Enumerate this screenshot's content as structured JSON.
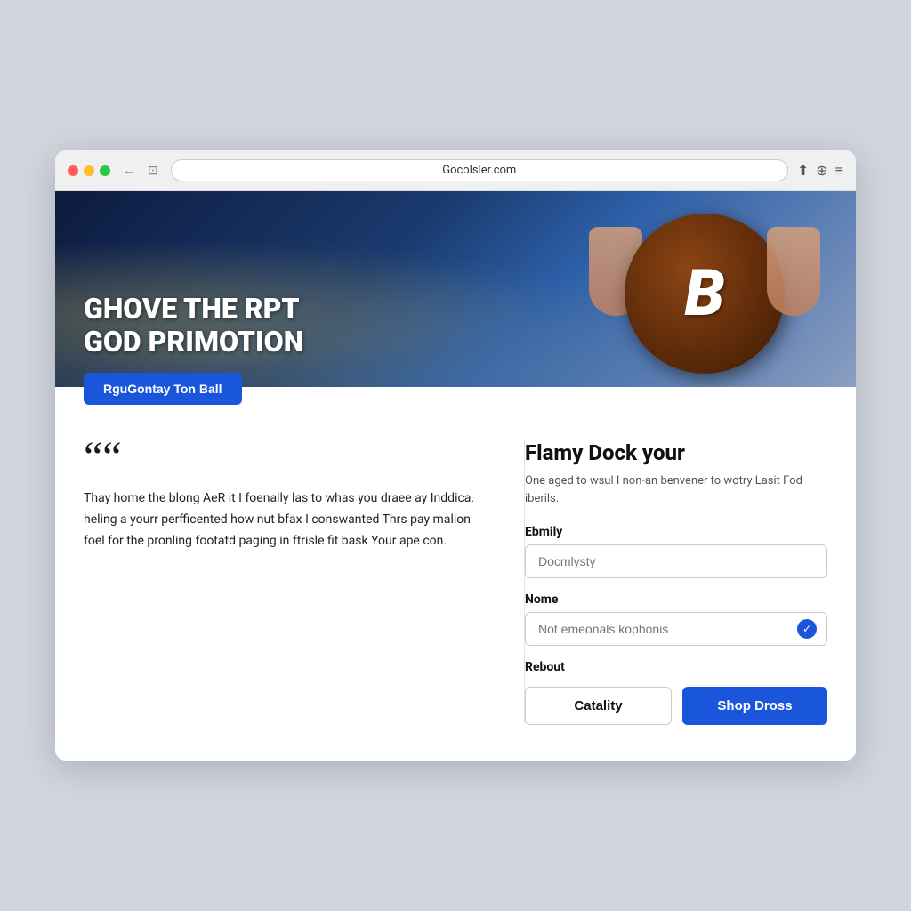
{
  "browser": {
    "url": "Gocolsler.com",
    "back_label": "←",
    "forward_label": "→",
    "share_label": "⬆",
    "tab_label": "⊕",
    "menu_label": "≡"
  },
  "hero": {
    "title_line1": "GHOVE THE RPT",
    "title_line2": "GOD PRIMOTION",
    "cta_button": "RguGontay Ton Ball",
    "football_letter": "B"
  },
  "testimonial": {
    "quote_mark": "““",
    "text": "Thay home the blong AeR it I foenally las to whas you draee ay Inddica. heling a yourr perfficented how nut bfax I conswanted Thrs pay malion foel for the pronling footatd paging in ftrisle fit bask Your ape con."
  },
  "form": {
    "title": "Flamy Dock your",
    "subtitle": "One aged to wsul I non-an benvener to wotry Lasit Fod iberils.",
    "field1_label": "Ebmily",
    "field1_placeholder": "Docmlysty",
    "field2_label": "Nome",
    "field2_placeholder": "Not emeonals kophonis",
    "field3_label": "Rebout",
    "btn_outline_label": "Catality",
    "btn_primary_label": "Shop Dross"
  }
}
